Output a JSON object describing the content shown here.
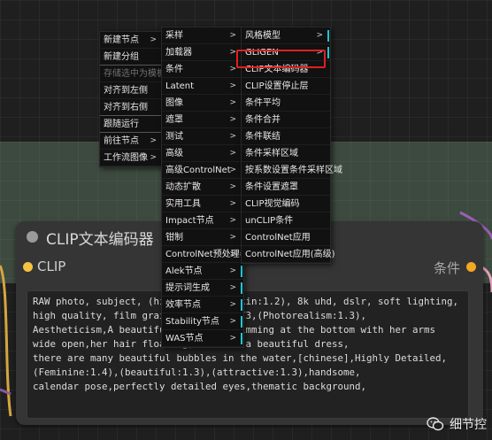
{
  "menu_level1": [
    {
      "label": "新建节点",
      "submenu": true,
      "disabled": false
    },
    {
      "label": "新建分组",
      "submenu": false,
      "disabled": false
    },
    {
      "label": "存储选中为模板",
      "submenu": false,
      "disabled": true
    },
    {
      "label": "对齐到左侧",
      "submenu": false,
      "disabled": false
    },
    {
      "label": "对齐到右侧",
      "submenu": false,
      "disabled": false
    },
    {
      "label": "跟随运行",
      "submenu": false,
      "disabled": false
    },
    {
      "label": "前往节点",
      "submenu": true,
      "disabled": false
    },
    {
      "label": "工作流图像",
      "submenu": true,
      "disabled": false
    }
  ],
  "menu_level2": [
    {
      "label": "采样",
      "submenu": true
    },
    {
      "label": "加载器",
      "submenu": true
    },
    {
      "label": "条件",
      "submenu": true
    },
    {
      "label": "Latent",
      "submenu": true
    },
    {
      "label": "图像",
      "submenu": true
    },
    {
      "label": "遮罩",
      "submenu": true
    },
    {
      "label": "测试",
      "submenu": true
    },
    {
      "label": "高级",
      "submenu": true
    },
    {
      "label": "高级ControlNet",
      "submenu": true
    },
    {
      "label": "动态扩散",
      "submenu": true
    },
    {
      "label": "实用工具",
      "submenu": true
    },
    {
      "label": "Impact节点",
      "submenu": true
    },
    {
      "label": "钳制",
      "submenu": true
    },
    {
      "label": "ControlNet预处理器",
      "submenu": true
    },
    {
      "label": "Alek节点",
      "submenu": true
    },
    {
      "label": "提示词生成",
      "submenu": true
    },
    {
      "label": "效率节点",
      "submenu": true
    },
    {
      "label": "Stability节点",
      "submenu": true
    },
    {
      "label": "WAS节点",
      "submenu": true
    }
  ],
  "menu_level3": [
    {
      "label": "风格模型",
      "submenu": true
    },
    {
      "label": "GLIGEN",
      "submenu": true
    },
    {
      "label": "CLIP文本编码器",
      "submenu": false
    },
    {
      "label": "CLIP设置停止层",
      "submenu": false
    },
    {
      "label": "条件平均",
      "submenu": false
    },
    {
      "label": "条件合并",
      "submenu": false
    },
    {
      "label": "条件联结",
      "submenu": false
    },
    {
      "label": "条件采样区域",
      "submenu": false
    },
    {
      "label": "按系数设置条件采样区域",
      "submenu": false
    },
    {
      "label": "条件设置遮罩",
      "submenu": false
    },
    {
      "label": "CLIP视觉编码",
      "submenu": false
    },
    {
      "label": "unCLIP条件",
      "submenu": false
    },
    {
      "label": "ControlNet应用",
      "submenu": false
    },
    {
      "label": "ControlNet应用(高级)",
      "submenu": false
    }
  ],
  "node": {
    "title": "CLIP文本编码器",
    "input_label": "CLIP",
    "output_label": "条件",
    "text": "RAW photo, subject, (high detailed skin:1.2), 8k uhd, dslr, soft lighting, high quality, film grain, Fujifilm XT3,(Photorealism:1.3),\nAestheticism,A beautiful girl was swimming at the bottom with her arms wide open,her hair floating,She wore a beautiful dress,\nthere are many beautiful bubbles in the water,[chinese],Highly Detailed,(Feminine:1.4),(beautiful:1.3),(attractive:1.3),handsome,\ncalendar pose,perfectly detailed eyes,thematic background,"
  },
  "watermark": {
    "text": "细节控",
    "icon": "wechat-icon"
  },
  "colors": {
    "accent_bar": "#1fc6d4",
    "highlight": "#e02020",
    "clip_slot": "#f5c242",
    "cond_slot": "#f5a623"
  }
}
